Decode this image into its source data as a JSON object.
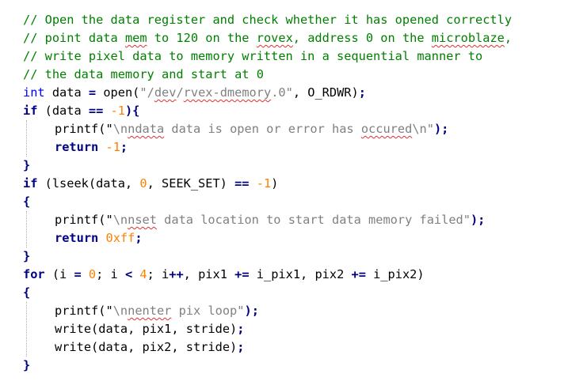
{
  "code": {
    "l1": "// Open the data register and check whether it has opened correctly",
    "l2a": "// point data ",
    "l2b": "mem",
    "l2c": " to 120 on the ",
    "l2d": "rovex",
    "l2e": ", address 0 on the ",
    "l2f": "microblaze",
    "l2g": ",",
    "l3": "// write pixel data to memory written in a sequential manner to",
    "l4": "// the data memory and start at 0",
    "l5_int": "int",
    "l5_a": " data ",
    "l5_eq": "=",
    "l5_b": " open(",
    "l5_s1": "\"/",
    "l5_dev": "dev",
    "l5_slash": "/",
    "l5_rx": "rvex-dmemory",
    "l5_s2": ".0\"",
    "l5_c": ", O_RDWR)",
    "if": "if",
    "return": "return",
    "for": "for",
    "l6_a": " (data ",
    "l6_eq": "==",
    "l6_neg1": "-1",
    "l6_c": "){",
    "printf_open": "printf(\"",
    "l7_esc": "\\n",
    "l7_sq": "ndata",
    "l7_rest": "data is open or error has ",
    "l7_occ": "occured",
    "l7_end": "\\n\"",
    "close_paren_semi": ");",
    "neg1": "-1",
    "semi": ";",
    "rbrace": "}",
    "lbrace": "{",
    "l10_a": " (lseek(data, ",
    "l10_zero": "0",
    "l10_b": ", SEEK_SET) ",
    "l10_eq": "==",
    "l10_neg1": "-1",
    "l10_c": ")",
    "l12_esc": "\\n",
    "l12_sq": "nset",
    "l12_rest": " data location to start data memory failed\"",
    "l13_val": "0xff",
    "l15_a": " (i ",
    "l15_eq": "=",
    "l15_zero": " 0",
    "l15_b": "; i ",
    "l15_lt": "<",
    "l15_four": " 4",
    "l15_c": "; i",
    "l15_pp": "++",
    "l15_d": ", pix1 ",
    "l15_pe1": "+=",
    "l15_e": " i_pix1, pix2 ",
    "l15_pe2": "+=",
    "l15_f": " i_pix2)",
    "l17_sq": "nenter",
    "l17_rest": " pix loop\"",
    "write_a": "write(data, pix1, stride)",
    "write_b": "write(data, pix2, stride)"
  }
}
